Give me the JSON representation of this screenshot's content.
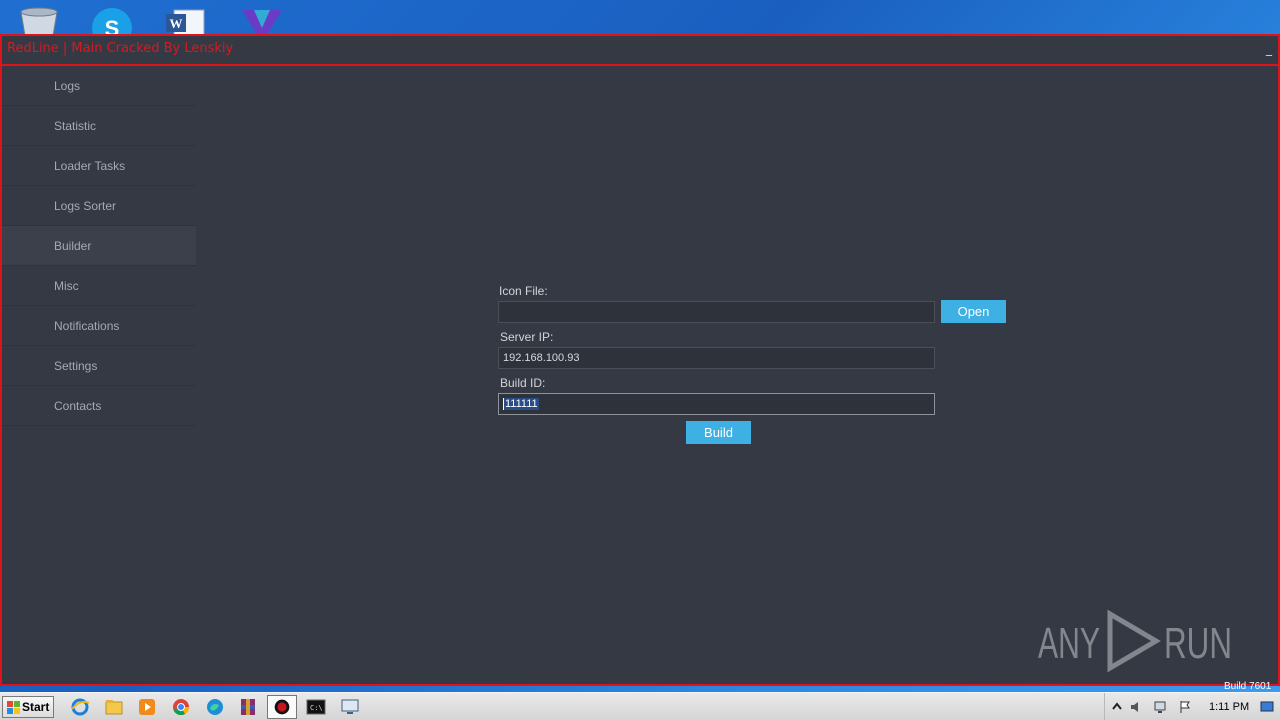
{
  "window": {
    "title": "RedLine | Main Cracked By Lenskiy",
    "minimize_glyph": "_"
  },
  "sidebar": {
    "active": "Builder",
    "items": [
      {
        "label": "Logs"
      },
      {
        "label": "Statistic"
      },
      {
        "label": "Loader Tasks"
      },
      {
        "label": "Logs Sorter"
      },
      {
        "label": "Builder"
      },
      {
        "label": "Misc"
      },
      {
        "label": "Notifications"
      },
      {
        "label": "Settings"
      },
      {
        "label": "Contacts"
      }
    ]
  },
  "builder": {
    "icon_file_label": "Icon File:",
    "icon_file_value": "",
    "open_button": "Open",
    "server_ip_label": "Server IP:",
    "server_ip_value": "192.168.100.93",
    "build_id_label": "Build ID:",
    "build_id_value": "111111",
    "build_button": "Build"
  },
  "watermark": {
    "text": "ANY RUN",
    "build_text": "Build 7601"
  },
  "taskbar": {
    "start_label": "Start",
    "clock": "1:11 PM",
    "icons": [
      "internet-explorer-icon",
      "folder-icon",
      "media-player-icon",
      "chrome-icon",
      "edge-icon",
      "winrar-icon",
      "redline-icon",
      "cmd-icon",
      "remote-icon"
    ]
  },
  "desktop_icons": [
    "recycle-bin-icon",
    "skype-icon",
    "word-icon",
    "app-v-icon"
  ],
  "colors": {
    "accent_red": "#e0121b",
    "button_blue": "#3fb0e4",
    "window_bg": "#353944"
  }
}
